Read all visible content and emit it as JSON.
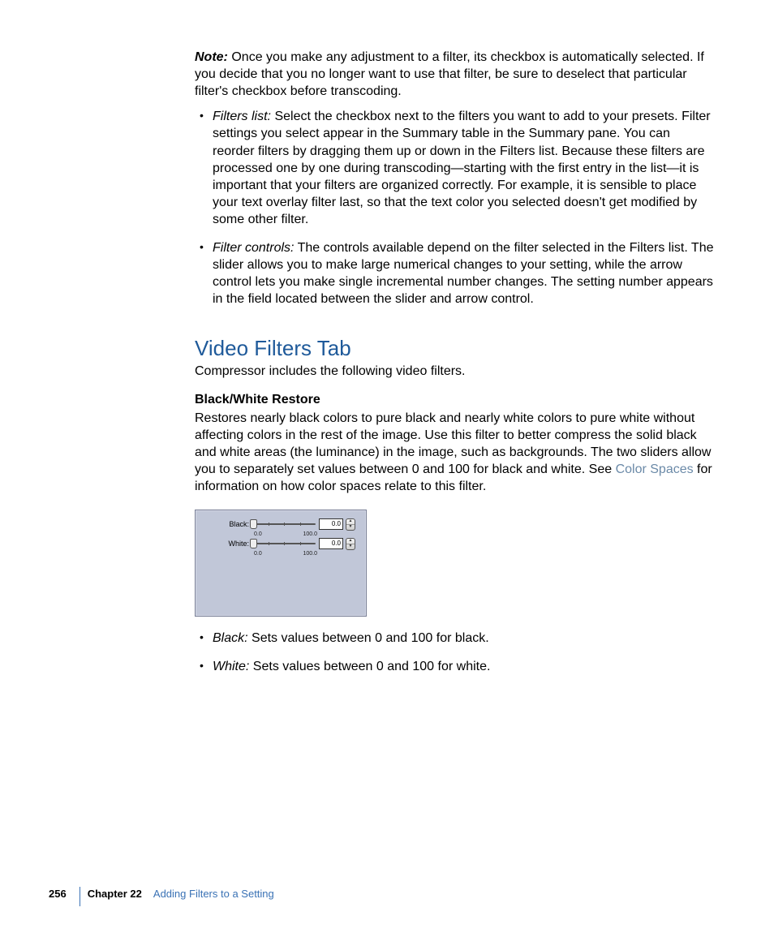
{
  "note": {
    "label": "Note:",
    "text": "Once you make any adjustment to a filter, its checkbox is automatically selected. If you decide that you no longer want to use that filter, be sure to deselect that particular filter's checkbox before transcoding."
  },
  "bullets1": [
    {
      "term": "Filters list:",
      "text": "Select the checkbox next to the filters you want to add to your presets. Filter settings you select appear in the Summary table in the Summary pane. You can reorder filters by dragging them up or down in the Filters list. Because these filters are processed one by one during transcoding—starting with the first entry in the list—it is important that your filters are organized correctly. For example, it is sensible to place your text overlay filter last, so that the text color you selected doesn't get modified by some other filter."
    },
    {
      "term": "Filter controls:",
      "text": "The controls available depend on the filter selected in the Filters list. The slider allows you to make large numerical changes to your setting, while the arrow control lets you make single incremental number changes. The setting number appears in the field located between the slider and arrow control."
    }
  ],
  "section_heading": "Video Filters Tab",
  "section_intro": "Compressor includes the following video filters.",
  "subsection_heading": "Black/White Restore",
  "subsection_body_pre": "Restores nearly black colors to pure black and nearly white colors to pure white without affecting colors in the rest of the image. Use this filter to better compress the solid black and white areas (the luminance) in the image, such as backgrounds. The two sliders allow you to separately set values between 0 and 100 for black and white. See ",
  "subsection_link": "Color Spaces",
  "subsection_body_post": " for information on how color spaces relate to this filter.",
  "panel": {
    "rows": [
      {
        "label": "Black:",
        "value": "0.0",
        "min": "0.0",
        "max": "100.0"
      },
      {
        "label": "White:",
        "value": "0.0",
        "min": "0.0",
        "max": "100.0"
      }
    ]
  },
  "bullets2": [
    {
      "term": "Black:",
      "text": "Sets values between 0 and 100 for black."
    },
    {
      "term": "White:",
      "text": "Sets values between 0 and 100 for white."
    }
  ],
  "footer": {
    "page": "256",
    "chapter_label": "Chapter 22",
    "chapter_title": "Adding Filters to a Setting"
  }
}
